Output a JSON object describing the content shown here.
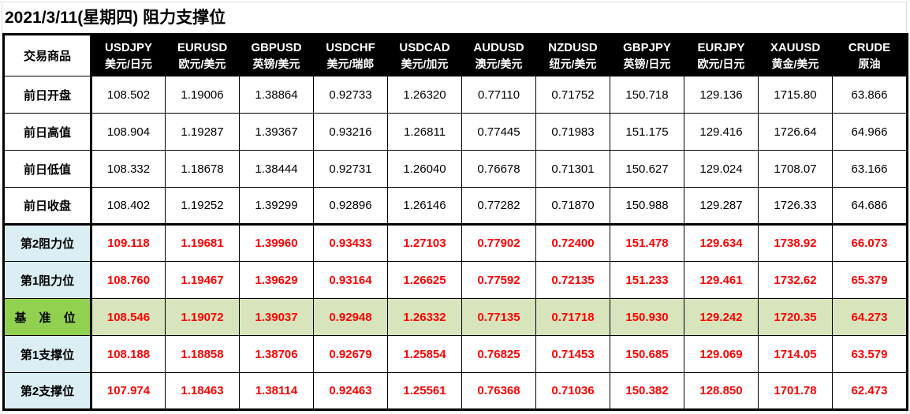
{
  "title": "2021/3/11(星期四) 阻力支撑位",
  "colors": {
    "header_bg": "#000000",
    "header_text": "#ffffff",
    "level_text": "#ff0000",
    "level_label_bg": "#daeef3",
    "pivot_label_bg": "#92d050",
    "pivot_row_bg": "#d8e4bc"
  },
  "table": {
    "corner_label": "交易商品",
    "columns": [
      {
        "code": "USDJPY",
        "name": "美元/日元"
      },
      {
        "code": "EURUSD",
        "name": "欧元/美元"
      },
      {
        "code": "GBPUSD",
        "name": "英镑/美元"
      },
      {
        "code": "USDCHF",
        "name": "美元/瑞郎"
      },
      {
        "code": "USDCAD",
        "name": "美元/加元"
      },
      {
        "code": "AUDUSD",
        "name": "澳元/美元"
      },
      {
        "code": "NZDUSD",
        "name": "纽元/美元"
      },
      {
        "code": "GBPJPY",
        "name": "英镑/日元"
      },
      {
        "code": "EURJPY",
        "name": "欧元/日元"
      },
      {
        "code": "XAUUSD",
        "name": "黄金/美元"
      },
      {
        "code": "CRUDE",
        "name": "原油"
      }
    ],
    "rows": [
      {
        "label": "前日开盘",
        "values": [
          "108.502",
          "1.19006",
          "1.38864",
          "0.92733",
          "1.26320",
          "0.77110",
          "0.71752",
          "150.718",
          "129.136",
          "1715.80",
          "63.866"
        ]
      },
      {
        "label": "前日高值",
        "values": [
          "108.904",
          "1.19287",
          "1.39367",
          "0.93216",
          "1.26811",
          "0.77445",
          "0.71983",
          "151.175",
          "129.416",
          "1726.64",
          "64.966"
        ]
      },
      {
        "label": "前日低值",
        "values": [
          "108.332",
          "1.18678",
          "1.38444",
          "0.92731",
          "1.26040",
          "0.76678",
          "0.71301",
          "150.627",
          "129.024",
          "1708.07",
          "63.166"
        ]
      },
      {
        "label": "前日收盘",
        "values": [
          "108.402",
          "1.19252",
          "1.39299",
          "0.92896",
          "1.26146",
          "0.77282",
          "0.71870",
          "150.988",
          "129.287",
          "1726.33",
          "64.686"
        ]
      },
      {
        "label": "第2阻力位",
        "values": [
          "109.118",
          "1.19681",
          "1.39960",
          "0.93433",
          "1.27103",
          "0.77902",
          "0.72400",
          "151.478",
          "129.634",
          "1738.92",
          "66.073"
        ]
      },
      {
        "label": "第1阻力位",
        "values": [
          "108.760",
          "1.19467",
          "1.39629",
          "0.93164",
          "1.26625",
          "0.77592",
          "0.72135",
          "151.233",
          "129.461",
          "1732.62",
          "65.379"
        ]
      },
      {
        "label": "基 准 位",
        "values": [
          "108.546",
          "1.19072",
          "1.39037",
          "0.92948",
          "1.26332",
          "0.77135",
          "0.71718",
          "150.930",
          "129.242",
          "1720.35",
          "64.273"
        ]
      },
      {
        "label": "第1支撑位",
        "values": [
          "108.188",
          "1.18858",
          "1.38706",
          "0.92679",
          "1.25854",
          "0.76825",
          "0.71453",
          "150.685",
          "129.069",
          "1714.05",
          "63.579"
        ]
      },
      {
        "label": "第2支撑位",
        "values": [
          "107.974",
          "1.18463",
          "1.38114",
          "0.92463",
          "1.25561",
          "0.76368",
          "0.71036",
          "150.382",
          "128.850",
          "1701.78",
          "62.473"
        ]
      }
    ]
  }
}
